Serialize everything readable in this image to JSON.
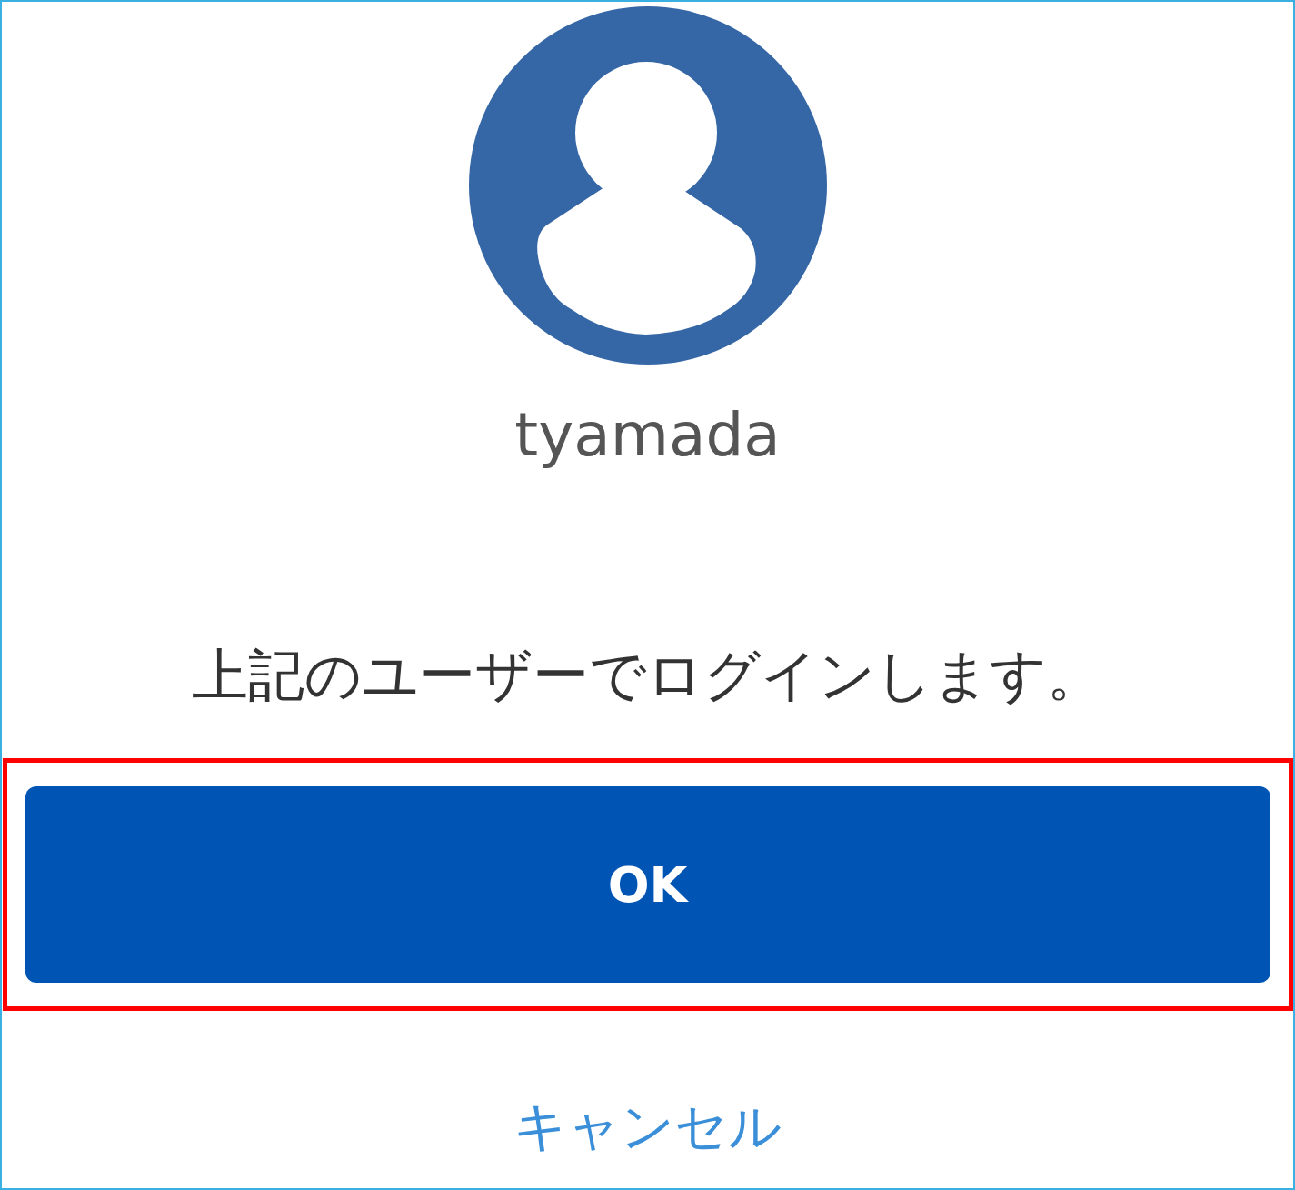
{
  "user": {
    "name": "tyamada"
  },
  "message": "上記のユーザーでログインします。",
  "ok_button": {
    "label": "OK",
    "highlighted": true
  },
  "cancel_link": {
    "label": "キャンセル"
  }
}
